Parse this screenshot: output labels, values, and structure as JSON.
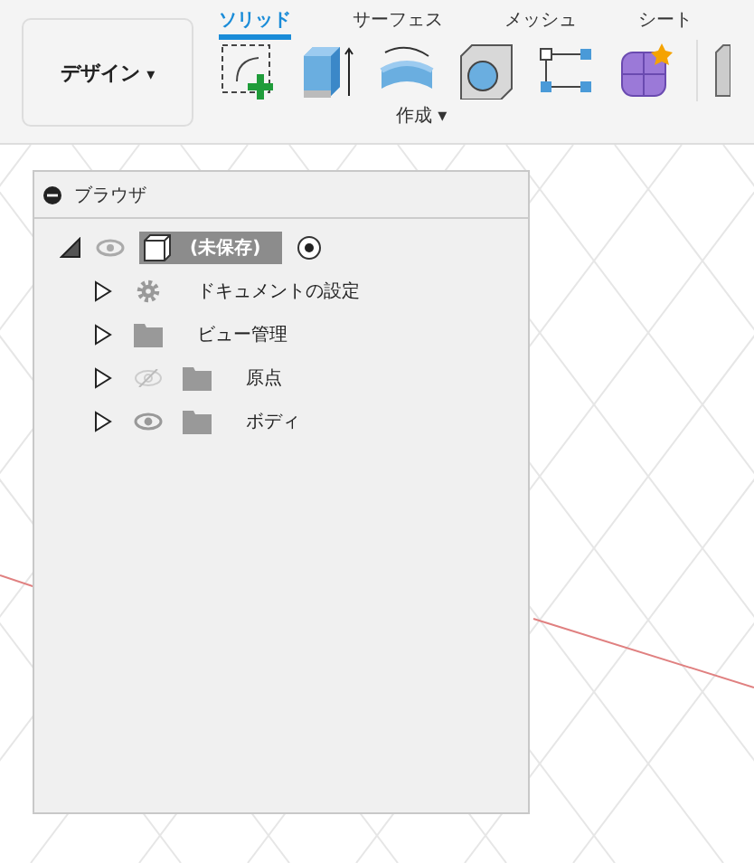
{
  "workspace_button": {
    "label": "デザイン",
    "caret": "▾"
  },
  "tabs": [
    {
      "label": "ソリッド",
      "selected": true
    },
    {
      "label": "サーフェス",
      "selected": false
    },
    {
      "label": "メッシュ",
      "selected": false
    },
    {
      "label": "シート",
      "selected": false
    }
  ],
  "toolbar": {
    "tools": [
      {
        "kind": "sketch"
      },
      {
        "kind": "extrude"
      },
      {
        "kind": "revolve"
      },
      {
        "kind": "hole"
      },
      {
        "kind": "pattern"
      },
      {
        "kind": "form"
      }
    ],
    "group_label": "作成",
    "group_caret": "▾"
  },
  "browser": {
    "title": "ブラウザ",
    "root": {
      "label": "(未保存)",
      "expanded": true,
      "selected": true,
      "visible": true,
      "active": true,
      "children": [
        {
          "label": "ドキュメントの設定",
          "kind": "gear",
          "expanded": false
        },
        {
          "label": "ビュー管理",
          "kind": "folder",
          "expanded": false
        },
        {
          "label": "原点",
          "kind": "folder",
          "expanded": false,
          "visible": false
        },
        {
          "label": "ボディ",
          "kind": "folder",
          "expanded": false,
          "visible": true
        }
      ]
    }
  }
}
